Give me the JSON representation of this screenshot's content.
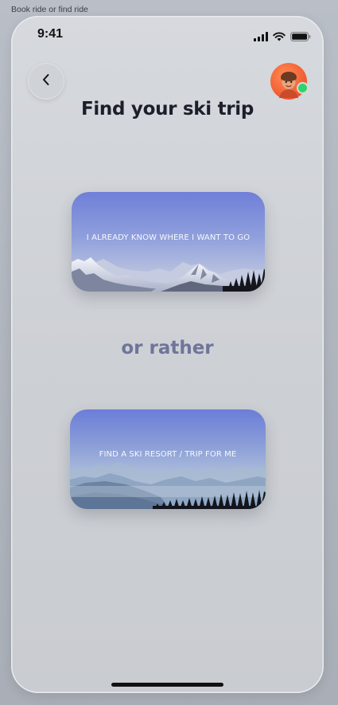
{
  "frame": {
    "label": "Book ride or find ride"
  },
  "status_bar": {
    "time": "9:41"
  },
  "header": {
    "title": "Find your ski trip"
  },
  "cards": [
    {
      "label": "I ALREADY KNOW WHERE I WANT TO GO"
    },
    {
      "label": "FIND A SKI RESORT / TRIP FOR ME"
    }
  ],
  "divider_text": "or rather",
  "colors": {
    "title": "#1c1f2a",
    "divider_text": "#6f7599",
    "online_dot": "#2fd36b",
    "avatar_bg": "#f0592e"
  },
  "icons": {
    "back": "chevron-left-icon",
    "signal": "signal-icon",
    "wifi": "wifi-icon",
    "battery": "battery-icon"
  }
}
